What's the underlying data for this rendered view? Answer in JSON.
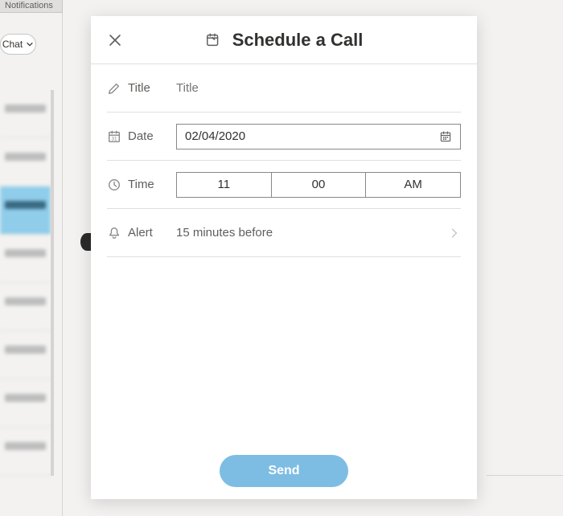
{
  "background": {
    "header_tab": "Notifications",
    "chat_pill": "Chat"
  },
  "modal": {
    "title": "Schedule a Call",
    "fields": {
      "title": {
        "label": "Title",
        "placeholder": "Title"
      },
      "date": {
        "label": "Date",
        "value": "02/04/2020"
      },
      "time": {
        "label": "Time",
        "hour": "11",
        "minute": "00",
        "ampm": "AM"
      },
      "alert": {
        "label": "Alert",
        "value": "15 minutes before"
      }
    },
    "send_label": "Send"
  }
}
